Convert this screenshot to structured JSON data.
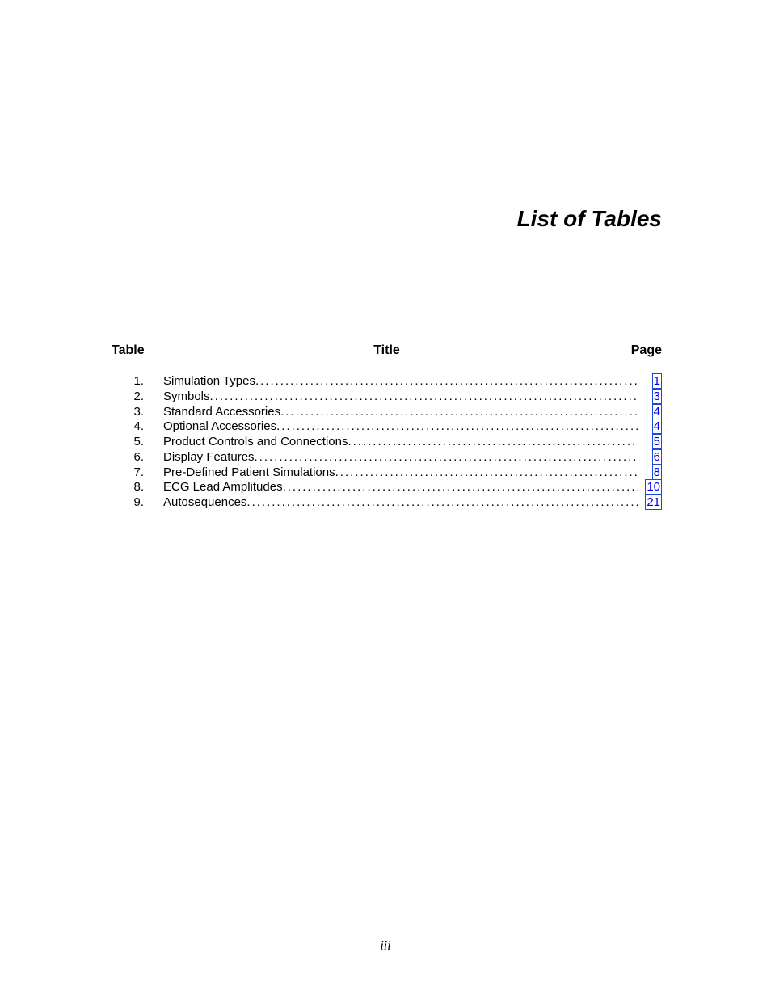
{
  "heading": "List of Tables",
  "columns": {
    "table": "Table",
    "title": "Title",
    "page": "Page"
  },
  "entries": [
    {
      "num": "1.",
      "title": "Simulation Types",
      "page": "1"
    },
    {
      "num": "2.",
      "title": "Symbols",
      "page": "3"
    },
    {
      "num": "3.",
      "title": "Standard Accessories",
      "page": "4"
    },
    {
      "num": "4.",
      "title": "Optional Accessories",
      "page": "4"
    },
    {
      "num": "5.",
      "title": "Product Controls and Connections",
      "page": "5"
    },
    {
      "num": "6.",
      "title": "Display Features",
      "page": "6"
    },
    {
      "num": "7.",
      "title": "Pre-Defined Patient Simulations",
      "page": "8"
    },
    {
      "num": "8.",
      "title": "ECG Lead Amplitudes",
      "page": "10"
    },
    {
      "num": "9.",
      "title": "Autosequences",
      "page": "21"
    }
  ],
  "footer": "iii"
}
